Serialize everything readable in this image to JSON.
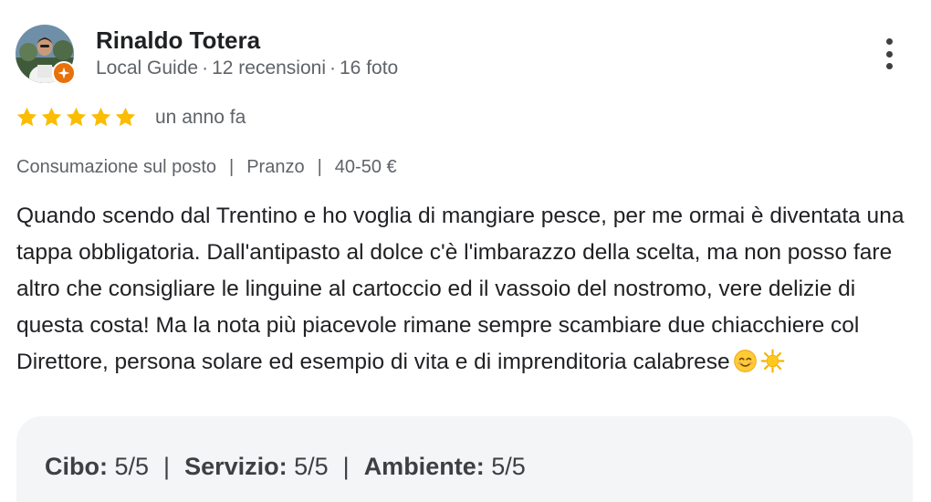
{
  "reviewer": {
    "name": "Rinaldo Totera",
    "level": "Local Guide",
    "reviews": "12 recensioni",
    "photos": "16 foto",
    "separator": "·"
  },
  "rating": {
    "stars": 5,
    "max_stars": 5,
    "time_ago": "un anno fa",
    "star_color": "#fbbc04"
  },
  "attributes": [
    "Consumazione sul posto",
    "Pranzo",
    "40-50 €"
  ],
  "review_text": "Quando scendo dal Trentino e ho voglia di mangiare pesce, per me ormai è diventata una tappa obbligatoria. Dall'antipasto al dolce c'è l'imbarazzo della scelta, ma non posso fare altro che consigliare le linguine al cartoccio ed il vassoio del nostromo, vere delizie di questa costa! Ma la nota più piacevole rimane sempre scambiare due chiacchiere col Direttore, persona solare ed esempio di vita e di imprenditoria calabrese",
  "review_emojis": [
    "smiling-face-emoji",
    "sun-emoji"
  ],
  "sub_ratings": [
    {
      "label": "Cibo:",
      "value": "5/5"
    },
    {
      "label": "Servizio:",
      "value": "5/5"
    },
    {
      "label": "Ambiente:",
      "value": "5/5"
    }
  ],
  "pipe": "|",
  "icons": {
    "avatar": "profile-photo",
    "badge": "local-guide-badge-icon",
    "menu": "more-vert-icon",
    "badge_color": "#e8710a"
  }
}
